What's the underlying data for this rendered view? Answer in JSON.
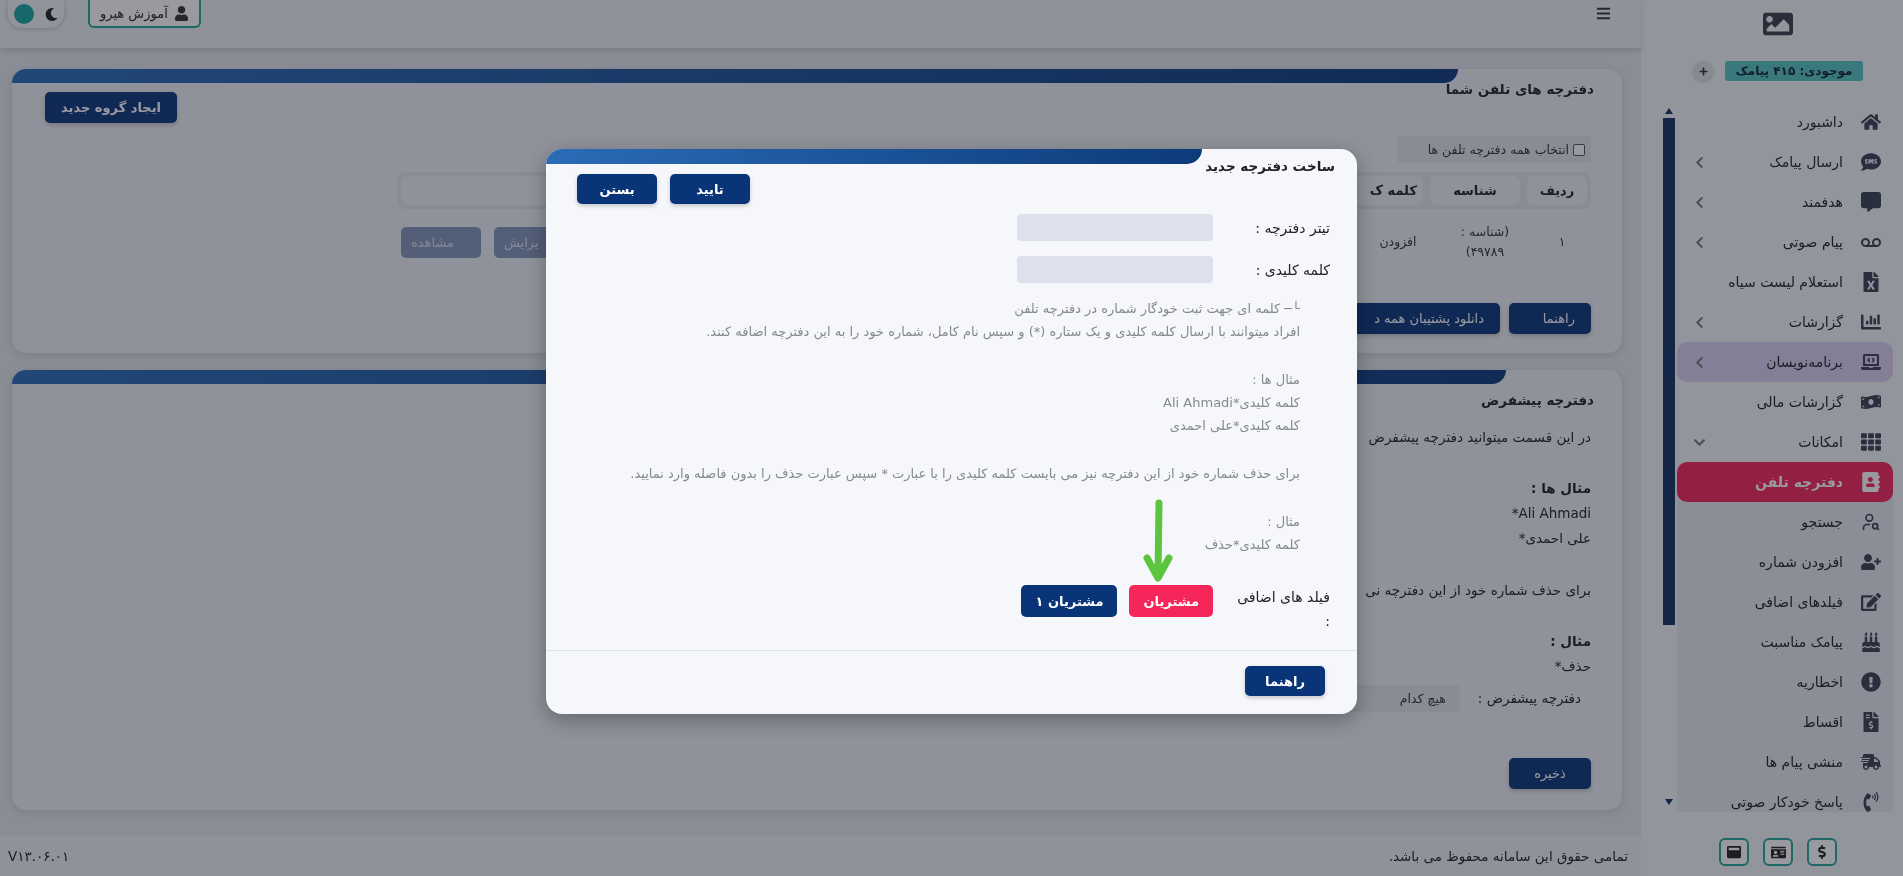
{
  "topbar": {
    "user_button": "آموزش هیرو"
  },
  "sidebar": {
    "balance": "موجودی: ۴۱۵ پیامک",
    "items": [
      {
        "label": "داشبورد",
        "selected": false,
        "highlighted": false
      },
      {
        "label": "ارسال پیامک",
        "selected": false,
        "highlighted": false,
        "expanded": false
      },
      {
        "label": "هدفمند",
        "selected": false,
        "highlighted": false,
        "expanded": false
      },
      {
        "label": "پیام صوتی",
        "selected": false,
        "highlighted": false,
        "expanded": false
      },
      {
        "label": "استعلام لیست سیاه",
        "selected": false,
        "highlighted": false
      },
      {
        "label": "گزارشات",
        "selected": false,
        "highlighted": false,
        "expanded": false
      },
      {
        "label": "برنامه‌نویسان",
        "selected": false,
        "highlighted": true,
        "expanded": false
      },
      {
        "label": "گزارشات مالی",
        "selected": false,
        "highlighted": false
      },
      {
        "label": "امکانات",
        "selected": false,
        "highlighted": false,
        "expanded": true,
        "children": [
          {
            "label": "دفترچه تلفن",
            "selected": true
          },
          {
            "label": "جستجو",
            "selected": false
          },
          {
            "label": "افزودن شماره",
            "selected": false
          },
          {
            "label": "فیلدهای اضافی",
            "selected": false
          },
          {
            "label": "پیامک مناسبت",
            "selected": false
          },
          {
            "label": "اخطاریه",
            "selected": false
          },
          {
            "label": "اقساط",
            "selected": false
          },
          {
            "label": "منشی پیام ها",
            "selected": false
          },
          {
            "label": "پاسخ خودکار صوتی",
            "selected": false
          }
        ]
      }
    ]
  },
  "phonebooks_card": {
    "title": "دفترچه های تلفن شما",
    "create_button": "ایجاد گروه جدید",
    "select_all": {
      "label": "انتخاب همه دفترچه تلفن ها",
      "checked": false
    },
    "columns": [
      "ردیف",
      "شناسه",
      "کلمه ک"
    ],
    "rows": [
      {
        "cells": [
          "۱",
          "(شناسه : ۴۹۷۸۹)",
          "افزودن"
        ],
        "actions": [
          "یرایش",
          "مشاهده"
        ]
      }
    ],
    "buttons": [
      "راهنما",
      "دانلود پشتیبان همه د"
    ]
  },
  "default_card": {
    "title": "دفترچه پیشفرض",
    "intro": "در این قسمت میتوانید دفترچه پیشفرض",
    "examples_title": "مثال ها :",
    "examples": [
      "Ali Ahmadi*",
      "علی احمدی*"
    ],
    "delete_text": "برای حذف شماره خود از این دفترچه نی",
    "delete_example_title": "مثال :",
    "delete_example": "حذف*",
    "default_label": "دفترچه پیشفرض :",
    "default_value": "هیچ کدام",
    "save_button": "ذخیره"
  },
  "footer": {
    "copyright": "تمامی حقوق این سامانه محفوظ می باشد.",
    "version": "V۱۳.۰۶.۰۱"
  },
  "modal": {
    "title": "ساخت دفترچه جدید",
    "header_buttons": [
      "تایید",
      "بستن"
    ],
    "fields": [
      {
        "label": "تیتر دفترچه :"
      },
      {
        "label": "کلمه کلیدی :"
      }
    ],
    "help": [
      {
        "lines": [
          "└─ کلمه ای جهت ثبت خودگار شماره در دفترچه تلفن",
          "افراد میتوانند با ارسال کلمه کلیدی و یک ستاره (*) و سپس نام کامل، شماره خود را به این دفترچه اضافه کنند."
        ]
      },
      {
        "lines": [
          "مثال ها :",
          "کلمه کلیدی*Ali Ahmadi",
          "کلمه کلیدی*علی احمدی"
        ]
      },
      {
        "lines": [
          "برای حذف شماره خود از این دفترچه نیز می بایست کلمه کلیدی را با عبارت * سپس عبارت حذف را بدون فاصله وارد نمایید."
        ]
      },
      {
        "lines": [
          "مثال :",
          "کلمه کلیدی*حذف"
        ]
      }
    ],
    "extra_fields_label": "فیلد های اضافی :",
    "extra_fields": [
      {
        "label": "مشتریان",
        "selected": true
      },
      {
        "label": "مشتریان ۱",
        "selected": false
      }
    ],
    "footer_button": "راهنما"
  }
}
